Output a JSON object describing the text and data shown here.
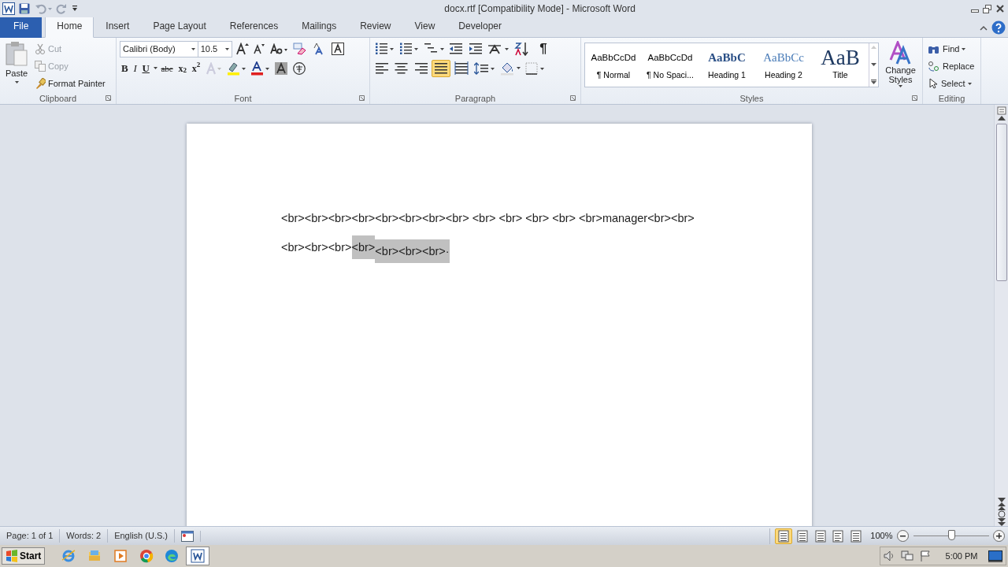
{
  "window": {
    "title": "docx.rtf [Compatibility Mode]  -  Microsoft Word"
  },
  "tabs": [
    {
      "label": "File",
      "kind": "file",
      "selected": false
    },
    {
      "label": "Home",
      "kind": "tab",
      "selected": true
    },
    {
      "label": "Insert",
      "kind": "tab",
      "selected": false
    },
    {
      "label": "Page Layout",
      "kind": "tab",
      "selected": false
    },
    {
      "label": "References",
      "kind": "tab",
      "selected": false
    },
    {
      "label": "Mailings",
      "kind": "tab",
      "selected": false
    },
    {
      "label": "Review",
      "kind": "tab",
      "selected": false
    },
    {
      "label": "View",
      "kind": "tab",
      "selected": false
    },
    {
      "label": "Developer",
      "kind": "tab",
      "selected": false
    }
  ],
  "clipboard": {
    "label": "Clipboard",
    "paste": "Paste",
    "cut": {
      "label": "Cut",
      "disabled": true
    },
    "copy": {
      "label": "Copy",
      "disabled": true
    },
    "format_painter": {
      "label": "Format Painter",
      "disabled": false
    }
  },
  "font": {
    "label": "Font",
    "family": "Calibri (Body)",
    "size": "10.5",
    "formats": [
      {
        "label": "B",
        "kind": "bold"
      },
      {
        "label": "I",
        "kind": "italic"
      },
      {
        "label": "U",
        "kind": "underline"
      },
      {
        "label": "abc",
        "kind": "strike"
      },
      {
        "label": "x$_{2}$",
        "kind": "script"
      },
      {
        "label": "x$^{2}$",
        "kind": "script"
      }
    ]
  },
  "paragraph": {
    "label": "Paragraph",
    "marks": "¶",
    "alignments": [
      {
        "kind": "left",
        "selected": false
      },
      {
        "kind": "center",
        "selected": false
      },
      {
        "kind": "right",
        "selected": false
      },
      {
        "kind": "justify",
        "selected": true
      },
      {
        "kind": "distributed",
        "selected": false
      }
    ]
  },
  "styles": {
    "label": "Styles",
    "items": [
      {
        "preview": "AaBbCcDd",
        "name": "¶ Normal",
        "kind": "normal"
      },
      {
        "preview": "AaBbCcDd",
        "name": "¶ No Spaci...",
        "kind": "normal"
      },
      {
        "preview": "AaBbC",
        "name": "Heading 1",
        "kind": "heading1"
      },
      {
        "preview": "AaBbCc",
        "name": "Heading 2",
        "kind": "heading2"
      },
      {
        "preview": "AaB",
        "name": "Title",
        "kind": "title"
      }
    ],
    "change_styles": "Change Styles"
  },
  "editing": {
    "label": "Editing",
    "find": "Find",
    "replace": "Replace",
    "select": "Select"
  },
  "document": {
    "lines": [
      [
        {
          "text": "<br><br><br><br><br><br><br><br> <br> <br> <br> <br> <br>manager<br><br>",
          "highlighted": false
        }
      ],
      [
        {
          "text": "<br><br><br>",
          "highlighted": false
        },
        {
          "text": "<br>",
          "highlighted": true
        },
        {
          "text": "<br><br><br>·",
          "highlighted": true,
          "lowered": true
        }
      ]
    ]
  },
  "status_bar": {
    "page": "Page: 1 of 1",
    "words": "Words: 2",
    "language": "English (U.S.)",
    "views": [
      {
        "kind": "print",
        "selected": true
      },
      {
        "kind": "reading",
        "selected": false
      },
      {
        "kind": "web",
        "selected": false
      },
      {
        "kind": "outline",
        "selected": false
      },
      {
        "kind": "draft",
        "selected": false
      }
    ],
    "zoom": "100%",
    "zoom_slider": {
      "level": 0.5
    }
  },
  "taskbar": {
    "start": "Start",
    "apps": [
      {
        "kind": "ie",
        "selected": false
      },
      {
        "kind": "explorer",
        "selected": false
      },
      {
        "kind": "media",
        "selected": false
      },
      {
        "kind": "chrome",
        "selected": false
      },
      {
        "kind": "edge",
        "selected": false
      },
      {
        "kind": "word",
        "selected": true
      }
    ],
    "clock": "5:00 PM"
  }
}
